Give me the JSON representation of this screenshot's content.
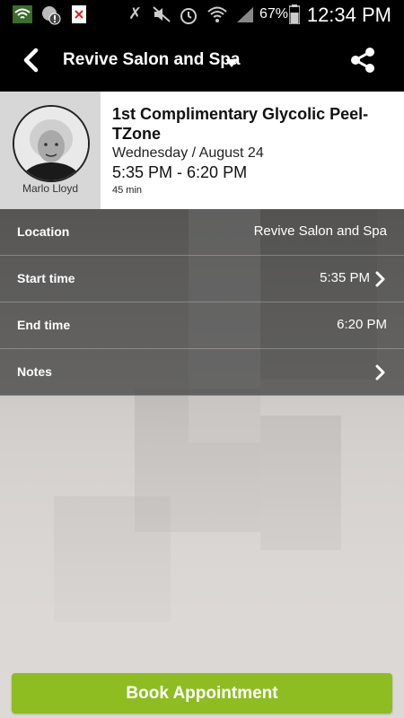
{
  "status_bar": {
    "battery_percent": "67%",
    "clock": "12:34 PM",
    "icons": [
      "wifi-icon",
      "alert-icon",
      "close-notification-icon",
      "bluetooth-icon",
      "mute-icon",
      "alarm-icon",
      "wifi-signal-icon",
      "cell-signal-icon",
      "battery-icon"
    ]
  },
  "app_bar": {
    "title": "Revive Salon and Spa",
    "back_icon": "back-arrow-icon",
    "share_icon": "share-icon"
  },
  "appointment": {
    "staff_name": "Marlo Lloyd",
    "title": "1st Complimentary Glycolic Peel-TZone",
    "date": "Wednesday / August 24",
    "time": "5:35 PM - 6:20 PM",
    "duration": "45 min"
  },
  "details": {
    "location": {
      "label": "Location",
      "value": "Revive Salon and Spa"
    },
    "start_time": {
      "label": "Start time",
      "value": "5:35 PM"
    },
    "end_time": {
      "label": "End time",
      "value": "6:20 PM"
    },
    "notes": {
      "label": "Notes",
      "value": ""
    }
  },
  "actions": {
    "book_label": "Book Appointment"
  },
  "colors": {
    "accent": "#8ebd22",
    "app_bar": "#000000",
    "row_bg": "#464646"
  }
}
